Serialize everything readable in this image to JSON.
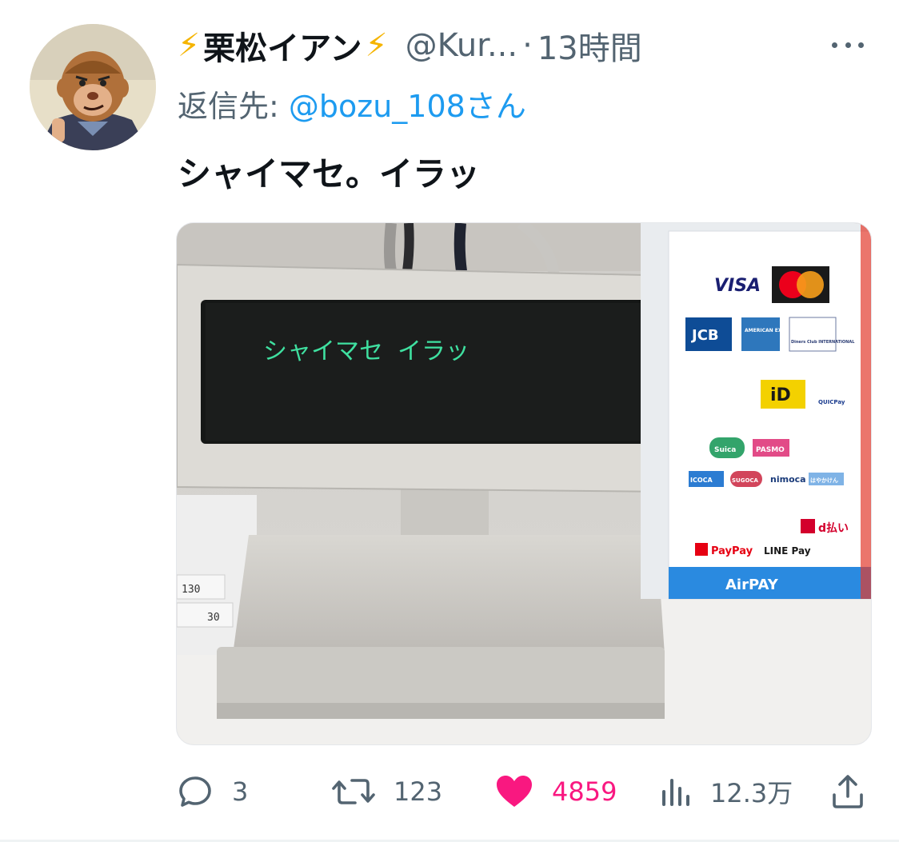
{
  "tweet": {
    "author_name": "栗松イアン",
    "author_emoji": "⚡",
    "handle": "@Kur...",
    "separator": "·",
    "time": "13時間",
    "reply_prefix": "返信先:",
    "reply_mention": "@bozu_108さん",
    "text": "シャイマセ。イラッ"
  },
  "media": {
    "display_text": "シャイマセ イラッ",
    "payment_logos": [
      "VISA",
      "JCB",
      "AMERICAN EXPRESS",
      "Diners Club INTERNATIONAL",
      "iD",
      "QUICPay",
      "Suica",
      "PASMO",
      "ICOCA",
      "SUGOCA",
      "nimoca",
      "はやかけん",
      "d払い",
      "PayPay",
      "LINE Pay",
      "AirPAY"
    ],
    "label_30": "30",
    "label_130": "130"
  },
  "actions": {
    "replies": "3",
    "retweets": "123",
    "likes": "4859",
    "views": "12.3万"
  },
  "icons": {
    "reply": "reply-icon",
    "retweet": "retweet-icon",
    "like": "heart-icon",
    "views": "views-icon",
    "share": "share-icon",
    "more": "more-icon"
  },
  "colors": {
    "accent": "#1d9bf0",
    "like": "#f91880",
    "secondary": "#536471",
    "bolt": "#f5b400",
    "display_text": "#3fe0a0"
  }
}
